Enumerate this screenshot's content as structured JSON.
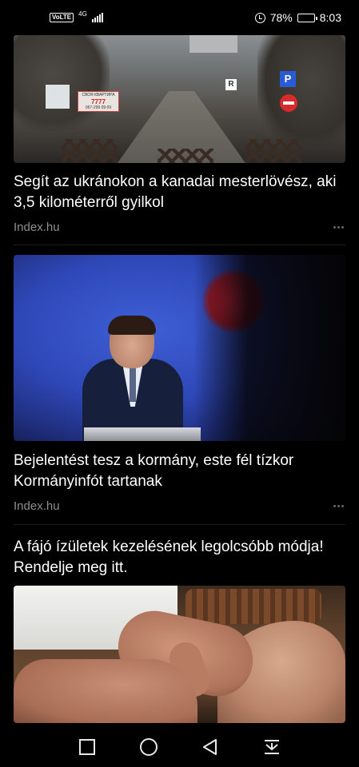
{
  "status_bar": {
    "volte": "VoLTE",
    "network": "4G",
    "battery_percent": "78%",
    "battery_level": 0.78,
    "time": "8:03"
  },
  "feed": {
    "items": [
      {
        "type": "article",
        "headline": "Segít az ukránokon a kanadai mesterlövész, aki 3,5 kilométerről gyilkol",
        "source": "Index.hu",
        "image": {
          "billboard_text": "СВОЯ КВАРТИРА",
          "billboard_number": "7777",
          "billboard_phone": "067-299 09 09",
          "sign_letter": "P",
          "sign_letter_2": "R"
        }
      },
      {
        "type": "article",
        "headline": "Bejelentést tesz a kormány, este fél tízkor Kormányinfót tartanak",
        "source": "Index.hu"
      },
      {
        "type": "ad",
        "headline": "A fájó ízületek kezelésének legolcsóbb módja! Rendelje meg itt."
      }
    ]
  },
  "nav_bar": {
    "icons": [
      "recents-square-icon",
      "home-circle-icon",
      "back-triangle-icon",
      "notification-pulldown-icon"
    ]
  }
}
